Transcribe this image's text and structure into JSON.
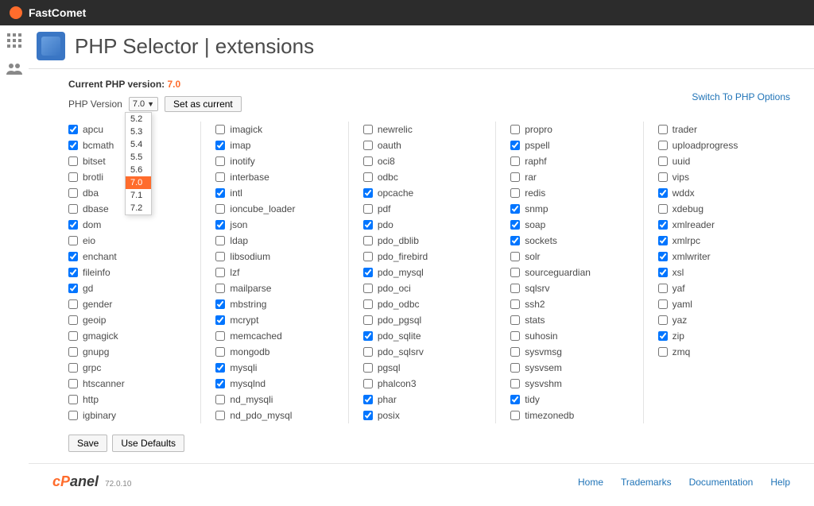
{
  "brand": "FastComet",
  "page_title": "PHP Selector | extensions",
  "current_version_label": "Current PHP version:",
  "current_version_value": "7.0",
  "php_version_label": "PHP Version",
  "selected_version": "7.0",
  "set_current_label": "Set as current",
  "switch_link": "Switch To PHP Options",
  "version_options": [
    "5.2",
    "5.3",
    "5.4",
    "5.5",
    "5.6",
    "7.0",
    "7.1",
    "7.2"
  ],
  "save_label": "Save",
  "defaults_label": "Use Defaults",
  "cpanel_version": "72.0.10",
  "footer_links": {
    "home": "Home",
    "trademarks": "Trademarks",
    "documentation": "Documentation",
    "help": "Help"
  },
  "extensions": [
    [
      {
        "name": "apcu",
        "checked": true
      },
      {
        "name": "bcmath",
        "checked": true
      },
      {
        "name": "bitset",
        "checked": false
      },
      {
        "name": "brotli",
        "checked": false
      },
      {
        "name": "dba",
        "checked": false
      },
      {
        "name": "dbase",
        "checked": false
      },
      {
        "name": "dom",
        "checked": true
      },
      {
        "name": "eio",
        "checked": false
      },
      {
        "name": "enchant",
        "checked": true
      },
      {
        "name": "fileinfo",
        "checked": true
      },
      {
        "name": "gd",
        "checked": true
      },
      {
        "name": "gender",
        "checked": false
      },
      {
        "name": "geoip",
        "checked": false
      },
      {
        "name": "gmagick",
        "checked": false
      },
      {
        "name": "gnupg",
        "checked": false
      },
      {
        "name": "grpc",
        "checked": false
      },
      {
        "name": "htscanner",
        "checked": false
      },
      {
        "name": "http",
        "checked": false
      },
      {
        "name": "igbinary",
        "checked": false
      }
    ],
    [
      {
        "name": "imagick",
        "checked": false
      },
      {
        "name": "imap",
        "checked": true
      },
      {
        "name": "inotify",
        "checked": false
      },
      {
        "name": "interbase",
        "checked": false
      },
      {
        "name": "intl",
        "checked": true
      },
      {
        "name": "ioncube_loader",
        "checked": false
      },
      {
        "name": "json",
        "checked": true
      },
      {
        "name": "ldap",
        "checked": false
      },
      {
        "name": "libsodium",
        "checked": false
      },
      {
        "name": "lzf",
        "checked": false
      },
      {
        "name": "mailparse",
        "checked": false
      },
      {
        "name": "mbstring",
        "checked": true
      },
      {
        "name": "mcrypt",
        "checked": true
      },
      {
        "name": "memcached",
        "checked": false
      },
      {
        "name": "mongodb",
        "checked": false
      },
      {
        "name": "mysqli",
        "checked": true
      },
      {
        "name": "mysqlnd",
        "checked": true
      },
      {
        "name": "nd_mysqli",
        "checked": false
      },
      {
        "name": "nd_pdo_mysql",
        "checked": false
      }
    ],
    [
      {
        "name": "newrelic",
        "checked": false
      },
      {
        "name": "oauth",
        "checked": false
      },
      {
        "name": "oci8",
        "checked": false
      },
      {
        "name": "odbc",
        "checked": false
      },
      {
        "name": "opcache",
        "checked": true
      },
      {
        "name": "pdf",
        "checked": false
      },
      {
        "name": "pdo",
        "checked": true
      },
      {
        "name": "pdo_dblib",
        "checked": false
      },
      {
        "name": "pdo_firebird",
        "checked": false
      },
      {
        "name": "pdo_mysql",
        "checked": true
      },
      {
        "name": "pdo_oci",
        "checked": false
      },
      {
        "name": "pdo_odbc",
        "checked": false
      },
      {
        "name": "pdo_pgsql",
        "checked": false
      },
      {
        "name": "pdo_sqlite",
        "checked": true
      },
      {
        "name": "pdo_sqlsrv",
        "checked": false
      },
      {
        "name": "pgsql",
        "checked": false
      },
      {
        "name": "phalcon3",
        "checked": false
      },
      {
        "name": "phar",
        "checked": true
      },
      {
        "name": "posix",
        "checked": true
      }
    ],
    [
      {
        "name": "propro",
        "checked": false
      },
      {
        "name": "pspell",
        "checked": true
      },
      {
        "name": "raphf",
        "checked": false
      },
      {
        "name": "rar",
        "checked": false
      },
      {
        "name": "redis",
        "checked": false
      },
      {
        "name": "snmp",
        "checked": true
      },
      {
        "name": "soap",
        "checked": true
      },
      {
        "name": "sockets",
        "checked": true
      },
      {
        "name": "solr",
        "checked": false
      },
      {
        "name": "sourceguardian",
        "checked": false
      },
      {
        "name": "sqlsrv",
        "checked": false
      },
      {
        "name": "ssh2",
        "checked": false
      },
      {
        "name": "stats",
        "checked": false
      },
      {
        "name": "suhosin",
        "checked": false
      },
      {
        "name": "sysvmsg",
        "checked": false
      },
      {
        "name": "sysvsem",
        "checked": false
      },
      {
        "name": "sysvshm",
        "checked": false
      },
      {
        "name": "tidy",
        "checked": true
      },
      {
        "name": "timezonedb",
        "checked": false
      }
    ],
    [
      {
        "name": "trader",
        "checked": false
      },
      {
        "name": "uploadprogress",
        "checked": false
      },
      {
        "name": "uuid",
        "checked": false
      },
      {
        "name": "vips",
        "checked": false
      },
      {
        "name": "wddx",
        "checked": true
      },
      {
        "name": "xdebug",
        "checked": false
      },
      {
        "name": "xmlreader",
        "checked": true
      },
      {
        "name": "xmlrpc",
        "checked": true
      },
      {
        "name": "xmlwriter",
        "checked": true
      },
      {
        "name": "xsl",
        "checked": true
      },
      {
        "name": "yaf",
        "checked": false
      },
      {
        "name": "yaml",
        "checked": false
      },
      {
        "name": "yaz",
        "checked": false
      },
      {
        "name": "zip",
        "checked": true
      },
      {
        "name": "zmq",
        "checked": false
      }
    ]
  ]
}
